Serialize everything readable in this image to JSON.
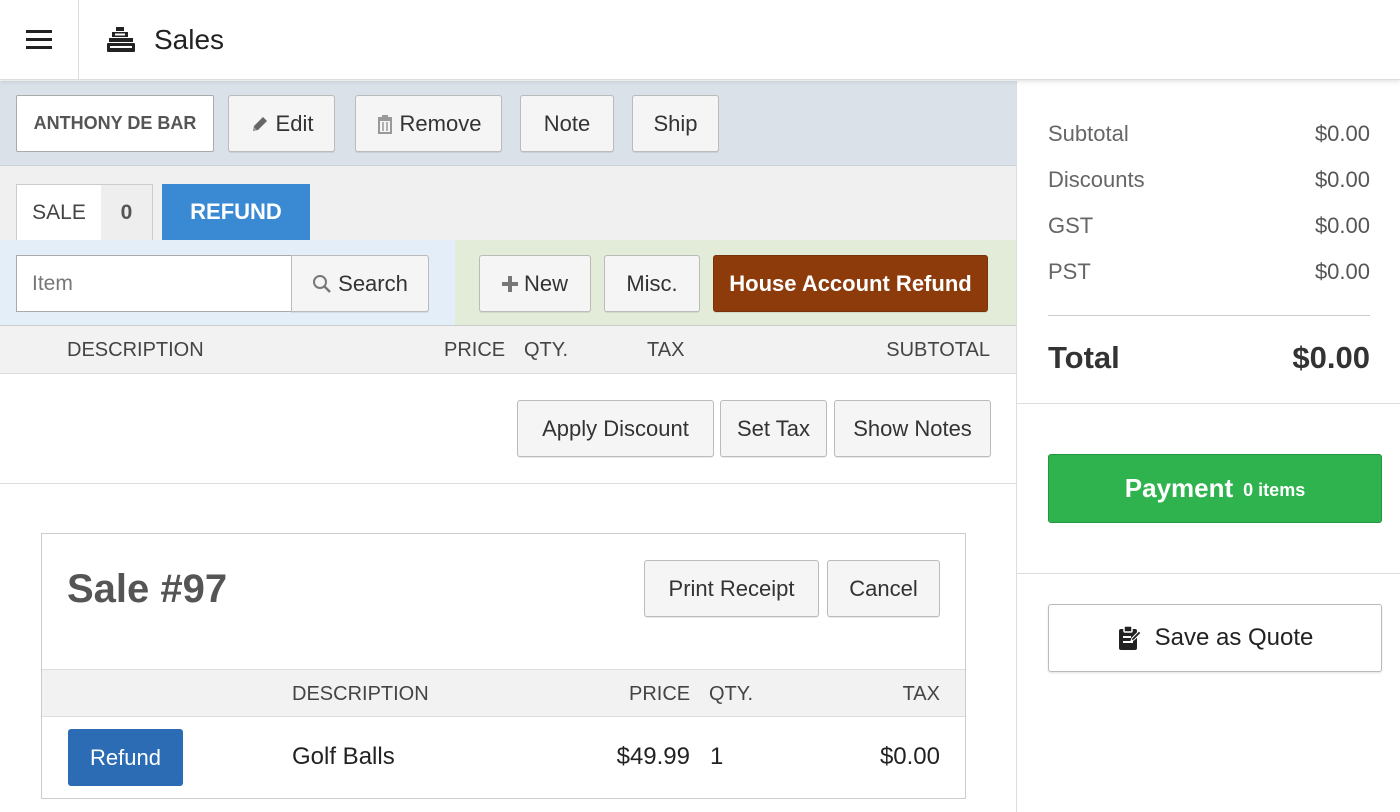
{
  "header": {
    "title": "Sales"
  },
  "customer": {
    "name": "ANTHONY DE BAR",
    "edit_label": "Edit",
    "remove_label": "Remove",
    "note_label": "Note",
    "ship_label": "Ship"
  },
  "tabs": {
    "sale_label": "SALE",
    "sale_count": "0",
    "refund_label": "REFUND"
  },
  "search": {
    "placeholder": "Item",
    "button_label": "Search"
  },
  "add": {
    "new_label": "New",
    "misc_label": "Misc.",
    "house_account_refund_label": "House Account Refund"
  },
  "columns": {
    "description": "DESCRIPTION",
    "price": "PRICE",
    "qty": "QTY.",
    "tax": "TAX",
    "subtotal": "SUBTOTAL"
  },
  "actions": {
    "apply_discount": "Apply Discount",
    "set_tax": "Set Tax",
    "show_notes": "Show Notes"
  },
  "sale": {
    "title": "Sale #97",
    "print_receipt": "Print Receipt",
    "cancel": "Cancel",
    "columns": {
      "description": "DESCRIPTION",
      "price": "PRICE",
      "qty": "QTY.",
      "tax": "TAX"
    },
    "rows": [
      {
        "action": "Refund",
        "description": "Golf Balls",
        "price": "$49.99",
        "qty": "1",
        "tax": "$0.00"
      }
    ]
  },
  "totals": {
    "subtotal_label": "Subtotal",
    "subtotal": "$0.00",
    "discounts_label": "Discounts",
    "discounts": "$0.00",
    "gst_label": "GST",
    "gst": "$0.00",
    "pst_label": "PST",
    "pst": "$0.00",
    "total_label": "Total",
    "total": "$0.00"
  },
  "payment": {
    "label": "Payment",
    "items": "0 items"
  },
  "quote": {
    "label": "Save as Quote"
  },
  "colors": {
    "refund_tab": "#3a89d3",
    "house_account": "#8e3b0c",
    "payment": "#2fb34f",
    "refund_button": "#2b6cb5"
  }
}
